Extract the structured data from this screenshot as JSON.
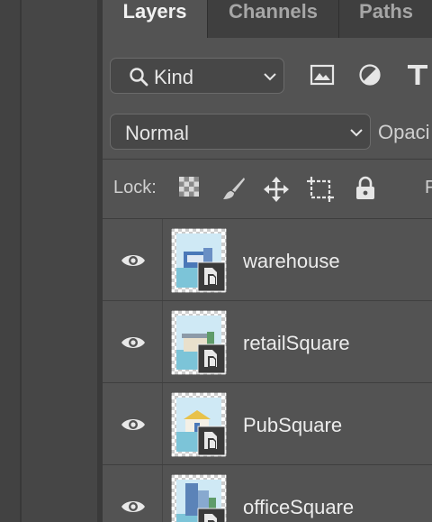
{
  "tabs": [
    {
      "label": "Layers",
      "active": true
    },
    {
      "label": "Channels",
      "active": false
    },
    {
      "label": "Paths",
      "active": false
    }
  ],
  "filter": {
    "kind_label": "Kind",
    "icons": [
      "search-icon",
      "image-filter-icon",
      "adjustment-filter-icon",
      "type-filter-icon"
    ]
  },
  "blend": {
    "mode": "Normal",
    "opacity_label": "Opaci"
  },
  "lock": {
    "label": "Lock:",
    "icons": [
      "lock-transparent-pixels-icon",
      "lock-image-pixels-icon",
      "lock-position-icon",
      "lock-artboard-icon",
      "lock-all-icon"
    ],
    "fill_label": "F"
  },
  "layers": [
    {
      "name": "warehouse",
      "visible": true
    },
    {
      "name": "retailSquare",
      "visible": true
    },
    {
      "name": "PubSquare",
      "visible": true
    },
    {
      "name": "officeSquare",
      "visible": true
    }
  ],
  "colors": {
    "panel_bg": "#535353",
    "tab_bar_bg": "#3f3f3f",
    "field_bg": "#474747",
    "text": "#e8e8e8",
    "thumb_sky": "#cfe9f5",
    "thumb_ground": "#7cc4d8"
  }
}
